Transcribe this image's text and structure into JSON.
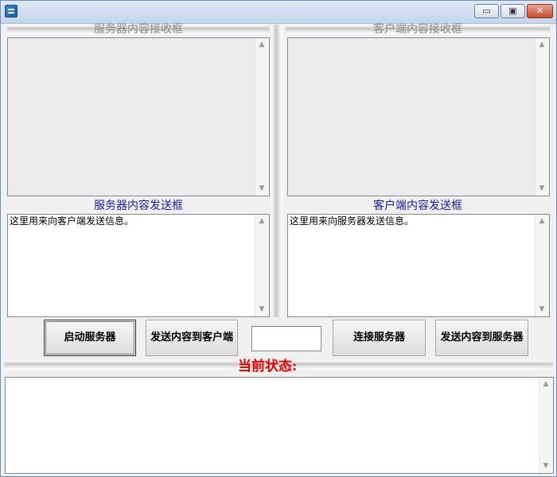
{
  "window": {
    "title": "",
    "controls": {
      "minimize": "▭",
      "maximize": "▣",
      "close": "✕"
    }
  },
  "server": {
    "receive_header": "服务器内容接收框",
    "receive_text": "",
    "send_header": "服务器内容发送框",
    "send_text": "这里用来向客户端发送信息。"
  },
  "client": {
    "receive_header": "客户端内容接收框",
    "receive_text": "",
    "send_header": "客户端内容发送框",
    "send_text": "这里用来向服务器发送信息。"
  },
  "buttons": {
    "start_server": "启动服务器",
    "send_to_client": "发送内容到客户端",
    "connect_server": "连接服务器",
    "send_to_server": "发送内容到服务器"
  },
  "middle_input": {
    "value": ""
  },
  "status": {
    "label": "当前状态:",
    "log": ""
  },
  "icons": {
    "scroll_up": "▲",
    "scroll_down": "▼"
  }
}
